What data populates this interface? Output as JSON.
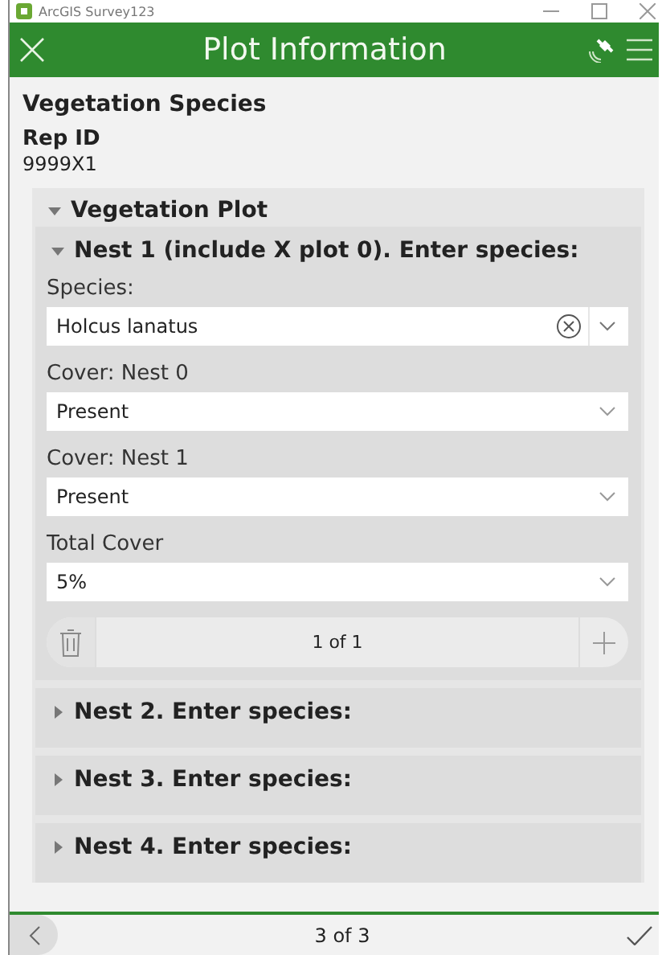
{
  "window": {
    "title": "ArcGIS Survey123"
  },
  "header": {
    "title": "Plot Information"
  },
  "form_title": "Vegetation Species",
  "rep_id": {
    "label": "Rep ID",
    "value": "9999X1"
  },
  "group": {
    "label": "Vegetation Plot",
    "expanded": true,
    "repeats": [
      {
        "label": "Nest 1 (include X plot 0). Enter species:",
        "expanded": true,
        "questions": [
          {
            "label": "Species:",
            "value": "Holcus lanatus",
            "kind": "clearable"
          },
          {
            "label": "Cover: Nest 0",
            "value": "Present",
            "kind": "select"
          },
          {
            "label": "Cover: Nest 1",
            "value": "Present",
            "kind": "select"
          },
          {
            "label": "Total Cover",
            "value": "5%",
            "kind": "select"
          }
        ],
        "pager": "1 of 1"
      },
      {
        "label": "Nest 2. Enter species:",
        "expanded": false
      },
      {
        "label": "Nest 3. Enter species:",
        "expanded": false
      },
      {
        "label": "Nest 4. Enter species:",
        "expanded": false
      }
    ]
  },
  "footer": {
    "page": "3 of 3"
  }
}
